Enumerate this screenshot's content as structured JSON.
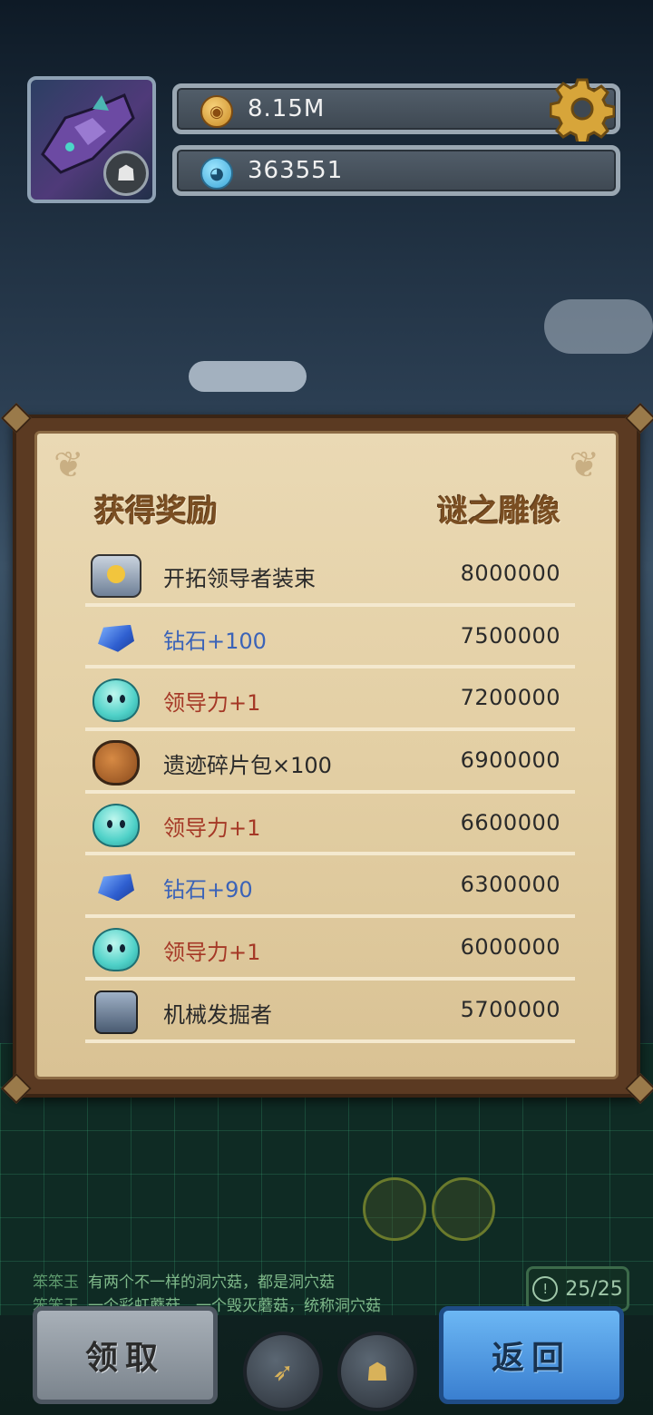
{
  "header": {
    "avatar_icon": "wolf-badge-icon",
    "coins": {
      "icon": "coin-icon",
      "value": "8.15M"
    },
    "crystals": {
      "icon": "blob-icon",
      "value": "363551"
    },
    "settings_icon": "gear-icon"
  },
  "panel": {
    "title_left": "获得奖励",
    "title_right": "谜之雕像",
    "rewards": [
      {
        "icon": "hero-portrait-icon",
        "label": "开拓领导者装束",
        "score": "8000000",
        "color": "default"
      },
      {
        "icon": "diamond-icon",
        "label": "钻石+100",
        "score": "7500000",
        "color": "blue"
      },
      {
        "icon": "slime-icon",
        "label": "领导力+1",
        "score": "7200000",
        "color": "red"
      },
      {
        "icon": "bag-icon",
        "label": "遗迹碎片包×100",
        "score": "6900000",
        "color": "default"
      },
      {
        "icon": "slime-icon",
        "label": "领导力+1",
        "score": "6600000",
        "color": "red"
      },
      {
        "icon": "diamond-icon",
        "label": "钻石+90",
        "score": "6300000",
        "color": "blue"
      },
      {
        "icon": "slime-icon",
        "label": "领导力+1",
        "score": "6000000",
        "color": "red"
      },
      {
        "icon": "robot-icon",
        "label": "机械发掘者",
        "score": "5700000",
        "color": "default"
      }
    ]
  },
  "chat": {
    "lines": [
      {
        "name": "笨笨玉",
        "text": "有两个不一样的洞穴菇，都是洞穴菇"
      },
      {
        "name": "笨笨玉",
        "text": "一个彩虹蘑菇，一个毁灭蘑菇，统称洞穴菇"
      }
    ]
  },
  "counter": {
    "value": "25/25"
  },
  "buttons": {
    "claim": "领取",
    "back": "返回",
    "rocket_icon": "rocket-icon",
    "bag_icon": "bag-icon"
  },
  "colors": {
    "label_blue": "#3b63b8",
    "label_red": "#a53826",
    "panel_title": "#7a4e22"
  }
}
